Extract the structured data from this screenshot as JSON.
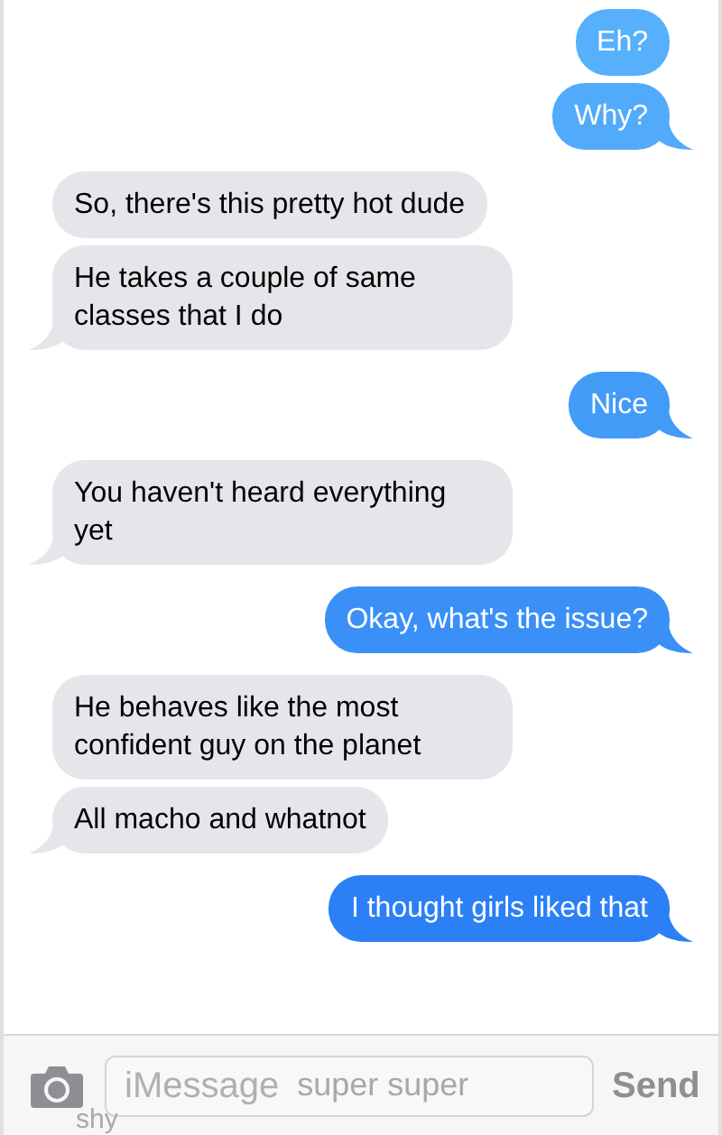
{
  "messages": [
    {
      "kind": "sent",
      "text": "Eh?"
    },
    {
      "kind": "sent",
      "text": "Why?"
    },
    {
      "kind": "received",
      "text": "So, there's this pretty hot dude"
    },
    {
      "kind": "received",
      "text": "He takes a couple of same classes that I do"
    },
    {
      "kind": "sent",
      "text": "Nice"
    },
    {
      "kind": "received",
      "text": "You haven't heard everything yet"
    },
    {
      "kind": "sent",
      "text": "Okay, what's the issue?"
    },
    {
      "kind": "received",
      "text": "He behaves like the most confident guy on the planet"
    },
    {
      "kind": "received",
      "text": "All macho and whatnot"
    },
    {
      "kind": "sent",
      "text": "I thought girls liked that"
    }
  ],
  "obscured_message": {
    "fragments": [
      "super super",
      "shy"
    ]
  },
  "composer": {
    "placeholder": "iMessage",
    "send_label": "Send"
  }
}
